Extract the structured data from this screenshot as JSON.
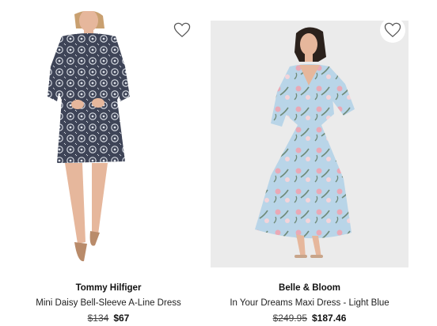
{
  "products": [
    {
      "brand": "Tommy Hilfiger",
      "name": "Mini Daisy Bell-Sleeve A-Line Dress",
      "price_original": "$134",
      "price_sale": "$67",
      "wishlist_icon": "heart-outline-icon"
    },
    {
      "brand": "Belle & Bloom",
      "name": "In Your Dreams Maxi Dress - Light Blue",
      "price_original": "$249.95",
      "price_sale": "$187.46",
      "wishlist_icon": "heart-outline-icon"
    }
  ],
  "colors": {
    "dress1_base": "#3e4457",
    "dress1_pattern": "#dfe3ea",
    "dress2_base": "#b9d5e8",
    "dress2_floral": "#e9a9b6",
    "dress2_leaf": "#6f8a78",
    "card2_background": "#ebebeb",
    "skin": "#e6b79c"
  }
}
